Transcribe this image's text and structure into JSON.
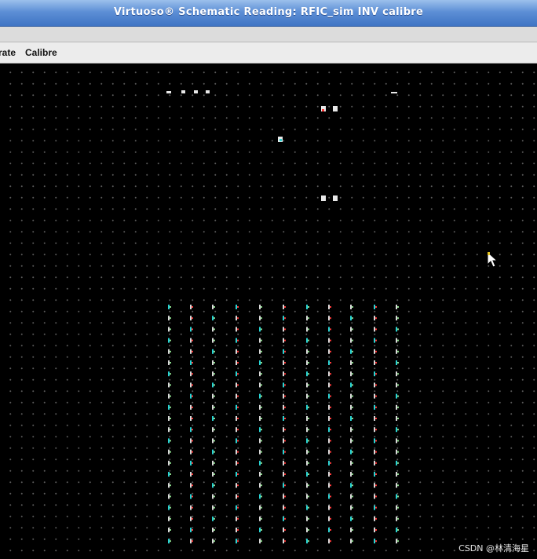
{
  "window": {
    "title": "Virtuoso® Schematic Reading: RFIC_sim INV calibre"
  },
  "menubar": {
    "items": [
      "rate",
      "Calibre"
    ]
  },
  "watermark": "CSDN @林清海星",
  "colors": {
    "canvas_bg": "#000000",
    "grid_dot": "#5a5a5a",
    "title_blue": "#4a7fcb",
    "pin_red": "#ff3a3a",
    "pin_cyan": "#29d3d3"
  },
  "icons": {
    "cursor": "arrow-pointer-icon"
  }
}
